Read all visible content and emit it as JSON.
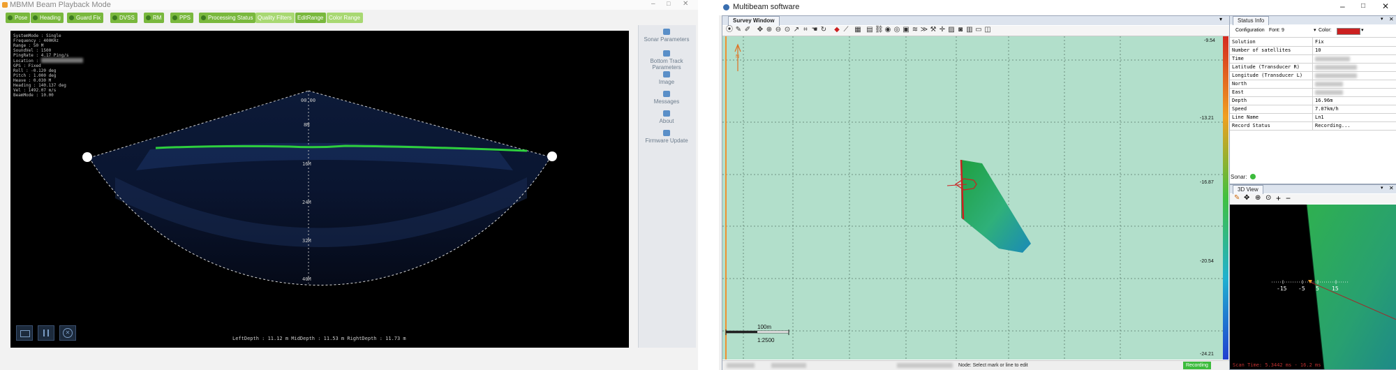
{
  "left_app": {
    "title": "MBMM Beam Playback Mode",
    "status_buttons": [
      "Pose",
      "Heading",
      "Guard Fix",
      "DVSS",
      "RM",
      "PPS",
      "Processing Status",
      "Quality Filters",
      "EditRange",
      "Color Range"
    ],
    "sidebar": [
      {
        "label": "Sonar Parameters",
        "icon": "sonar-settings-icon"
      },
      {
        "label": "Bottom Track Parameters",
        "icon": "bottom-track-icon"
      },
      {
        "label": "Image",
        "icon": "image-icon"
      },
      {
        "label": "Messages",
        "icon": "messages-icon"
      },
      {
        "label": "About",
        "icon": "about-icon"
      },
      {
        "label": "Firmware Update",
        "icon": "firmware-icon"
      }
    ],
    "sonar_info": [
      "SystemMode : Single",
      "Frequency : 400KHz",
      "Range : 50 M",
      "SoundVel : 1500",
      "PingRate : 4.17 Ping/s",
      "Location :",
      "GPS : Fixed",
      "Roll : -0.120 deg",
      "Pitch : 1.000 deg",
      "Heave : 0.030 M",
      "Heading : 140.137 deg",
      "Vel : 1492.07 m/s",
      "BeamMode : 10.00"
    ],
    "depth_scale": [
      "00.00",
      "8M",
      "16M",
      "24M",
      "32M",
      "40M"
    ],
    "depth_readout": "LeftDepth : 11.12 m  MidDepth : 11.53 m  RightDepth : 11.73 m",
    "controls": [
      {
        "name": "folder-button",
        "icon": "folder-icon"
      },
      {
        "name": "pause-button",
        "icon": "pause-icon"
      },
      {
        "name": "close-playback-button",
        "icon": "close-icon"
      }
    ],
    "colors": {
      "panel_bg": "#000000",
      "bottom_line": "#2ecf3d",
      "sector_fill": "#0b1730"
    }
  },
  "right_app": {
    "title": "Multibeam software",
    "survey_tab": "Survey Window",
    "survey_close": "▾",
    "depth_scale": [
      "-9.54",
      "-13.21",
      "-16.87",
      "-20.54",
      "-24.21"
    ],
    "scale_bar_label": "100m",
    "scale_ratio": "1:2500",
    "north_arrow_label": "N",
    "status_bar": {
      "node_text": "Node:  Select mark or line to edit",
      "recording": "Recording"
    },
    "status_info": {
      "tab": "Status Info",
      "config_label": "Configuration",
      "font_label": "Font:",
      "font_value": "9",
      "color_label": "Color:",
      "rows": [
        {
          "key": "Solution",
          "value": "Fix"
        },
        {
          "key": "Number of satellites",
          "value": "10"
        },
        {
          "key": "Time",
          "value": ""
        },
        {
          "key": "Latitude (Transducer R)",
          "value": ""
        },
        {
          "key": "Longitude (Transducer L)",
          "value": ""
        },
        {
          "key": "North",
          "value": ""
        },
        {
          "key": "East",
          "value": ""
        },
        {
          "key": "Depth",
          "value": "16.96m"
        },
        {
          "key": "Speed",
          "value": "7.07km/h"
        },
        {
          "key": "Line Name",
          "value": "Ln1"
        },
        {
          "key": "Record Status",
          "value": "Recording..."
        }
      ]
    },
    "sonar_label": "Sonar:",
    "view3d": {
      "tab": "3D View",
      "axis_ticks": [
        "-15",
        "-5",
        "5",
        "15"
      ],
      "footer": "Scan Time: 5.3442 ms - 16.2 ms"
    },
    "colors": {
      "map_bg": "#b2dfcb",
      "accent_red": "#cc2020",
      "recording": "#3dbb3d"
    }
  }
}
